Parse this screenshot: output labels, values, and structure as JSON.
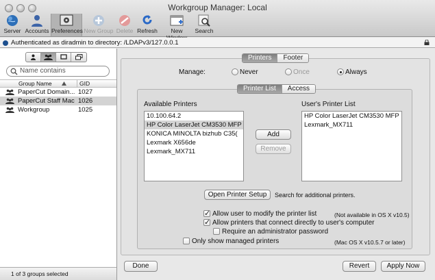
{
  "window": {
    "title": "Workgroup Manager: Local"
  },
  "toolbar": {
    "items": [
      {
        "label": "Server",
        "icon": "globe-icon",
        "enabled": true
      },
      {
        "label": "Accounts",
        "icon": "user-icon",
        "enabled": true
      },
      {
        "label": "Preferences",
        "icon": "preferences-icon",
        "enabled": true,
        "selected": true
      },
      {
        "label": "New Group",
        "icon": "plus-icon",
        "enabled": false
      },
      {
        "label": "Delete",
        "icon": "delete-icon",
        "enabled": false
      },
      {
        "label": "Refresh",
        "icon": "refresh-icon",
        "enabled": true
      },
      {
        "label": "New Window",
        "icon": "window-icon",
        "enabled": true
      },
      {
        "label": "Search",
        "icon": "search-icon",
        "enabled": true
      }
    ]
  },
  "status": {
    "text": "Authenticated as diradmin to directory: /LDAPv3/127.0.0.1"
  },
  "sidebar": {
    "search_placeholder": "Name contains",
    "columns": {
      "name": "Group Name",
      "gid": "GID"
    },
    "rows": [
      {
        "name": "PaperCut Domain...",
        "gid": "1027",
        "selected": false
      },
      {
        "name": "PaperCut Staff Mac",
        "gid": "1026",
        "selected": true
      },
      {
        "name": "Workgroup",
        "gid": "1025",
        "selected": false
      }
    ],
    "footer": "1 of 3 groups selected"
  },
  "top_tabs": [
    {
      "label": "Printers",
      "selected": true
    },
    {
      "label": "Footer",
      "selected": false
    }
  ],
  "manage": {
    "label": "Manage:",
    "options": [
      {
        "label": "Never",
        "checked": false,
        "enabled": true
      },
      {
        "label": "Once",
        "checked": false,
        "enabled": false
      },
      {
        "label": "Always",
        "checked": true,
        "enabled": true
      }
    ]
  },
  "sub_tabs": [
    {
      "label": "Printer List",
      "selected": true
    },
    {
      "label": "Access",
      "selected": false
    }
  ],
  "available": {
    "title": "Available Printers",
    "items": [
      {
        "label": "10.100.64.2",
        "selected": false
      },
      {
        "label": "HP Color LaserJet CM3530 MFP",
        "selected": true
      },
      {
        "label": "KONICA MINOLTA bizhub C35(",
        "selected": false
      },
      {
        "label": "Lexmark X656de",
        "selected": false
      },
      {
        "label": "Lexmark_MX711",
        "selected": false
      }
    ]
  },
  "user_list": {
    "title": "User's Printer List",
    "items": [
      {
        "label": "HP Color LaserJet CM3530 MFP"
      },
      {
        "label": "Lexmark_MX711"
      }
    ]
  },
  "buttons": {
    "add": "Add",
    "remove": "Remove",
    "open_setup": "Open Printer Setup",
    "done": "Done",
    "revert": "Revert",
    "apply": "Apply Now"
  },
  "setup_hint": "Search for additional printers.",
  "options": [
    {
      "label": "Allow user to modify the printer list",
      "checked": true,
      "note": "(Not available in OS X v10.5)"
    },
    {
      "label": "Allow printers that connect directly to user's computer",
      "checked": true,
      "note": ""
    },
    {
      "label": "Require an administrator password",
      "checked": false,
      "note": ""
    },
    {
      "label": "Only show managed printers",
      "checked": false,
      "note": "(Mac OS X v10.5.7 or later)"
    }
  ],
  "colors": {
    "selection": "#d4d4d4",
    "panel": "#e8e8e8",
    "tab_selected": "#8f8f8f"
  }
}
